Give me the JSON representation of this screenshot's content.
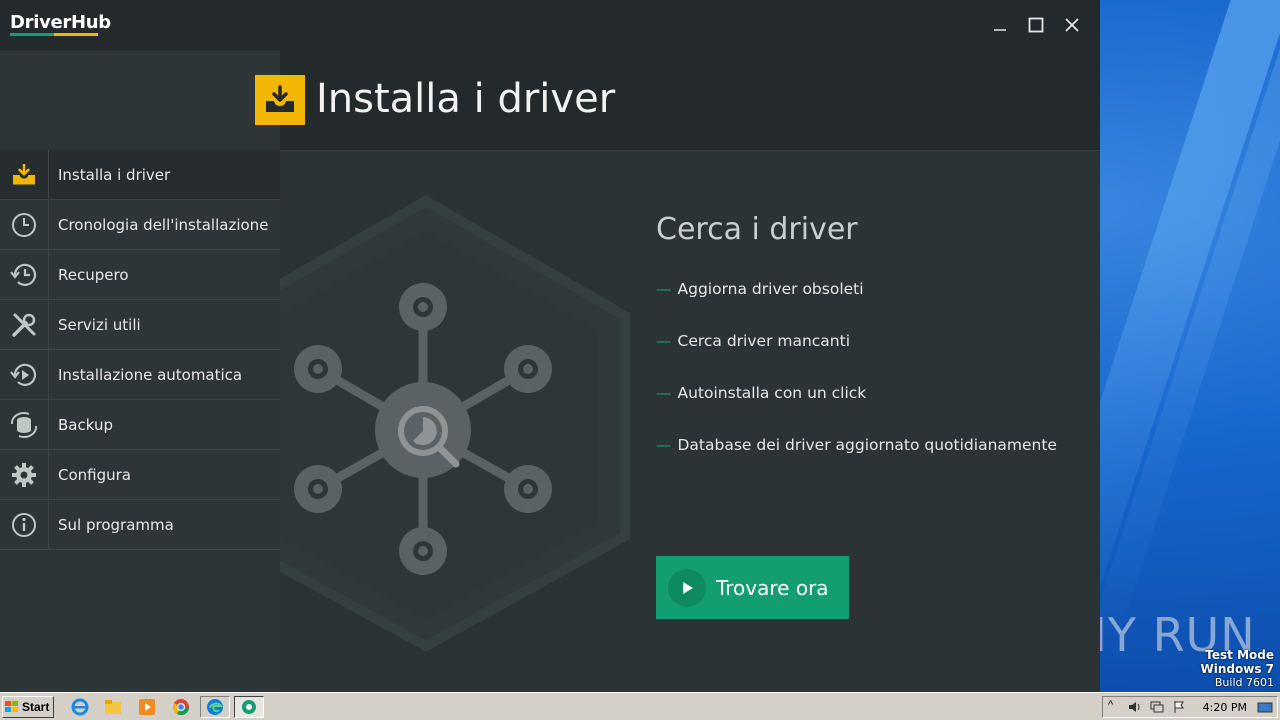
{
  "app": {
    "logo": "DriverHub",
    "window_controls": {
      "minimize": "minimize",
      "maximize": "maximize",
      "close": "close"
    }
  },
  "header": {
    "title": "Installa i driver",
    "icon": "download-tray-icon"
  },
  "sidebar": {
    "items": [
      {
        "label": "Installa i driver",
        "icon": "download-tray-icon",
        "active": true
      },
      {
        "label": "Cronologia dell'installazione",
        "icon": "clock-icon"
      },
      {
        "label": "Recupero",
        "icon": "history-icon"
      },
      {
        "label": "Servizi utili",
        "icon": "tools-icon"
      },
      {
        "label": "Installazione automatica",
        "icon": "auto-install-icon"
      },
      {
        "label": "Backup",
        "icon": "backup-icon"
      },
      {
        "label": "Configura",
        "icon": "gear-icon"
      },
      {
        "label": "Sul programma",
        "icon": "info-icon"
      }
    ]
  },
  "main": {
    "heading": "Cerca i driver",
    "features": [
      "Aggiorna driver obsoleti",
      "Cerca driver mancanti",
      "Autoinstalla con un click",
      "Database dei driver aggiornato quotidianamente"
    ],
    "cta_label": "Trovare ora"
  },
  "desktop": {
    "watermark": "ANY RUN",
    "test_mode": [
      "Test Mode",
      "Windows 7",
      "Build 7601"
    ]
  },
  "taskbar": {
    "start_label": "Start",
    "clock": "4:20 PM"
  },
  "colors": {
    "accent_green": "#129e70",
    "accent_yellow": "#f2b705",
    "panel": "#2d3536"
  }
}
